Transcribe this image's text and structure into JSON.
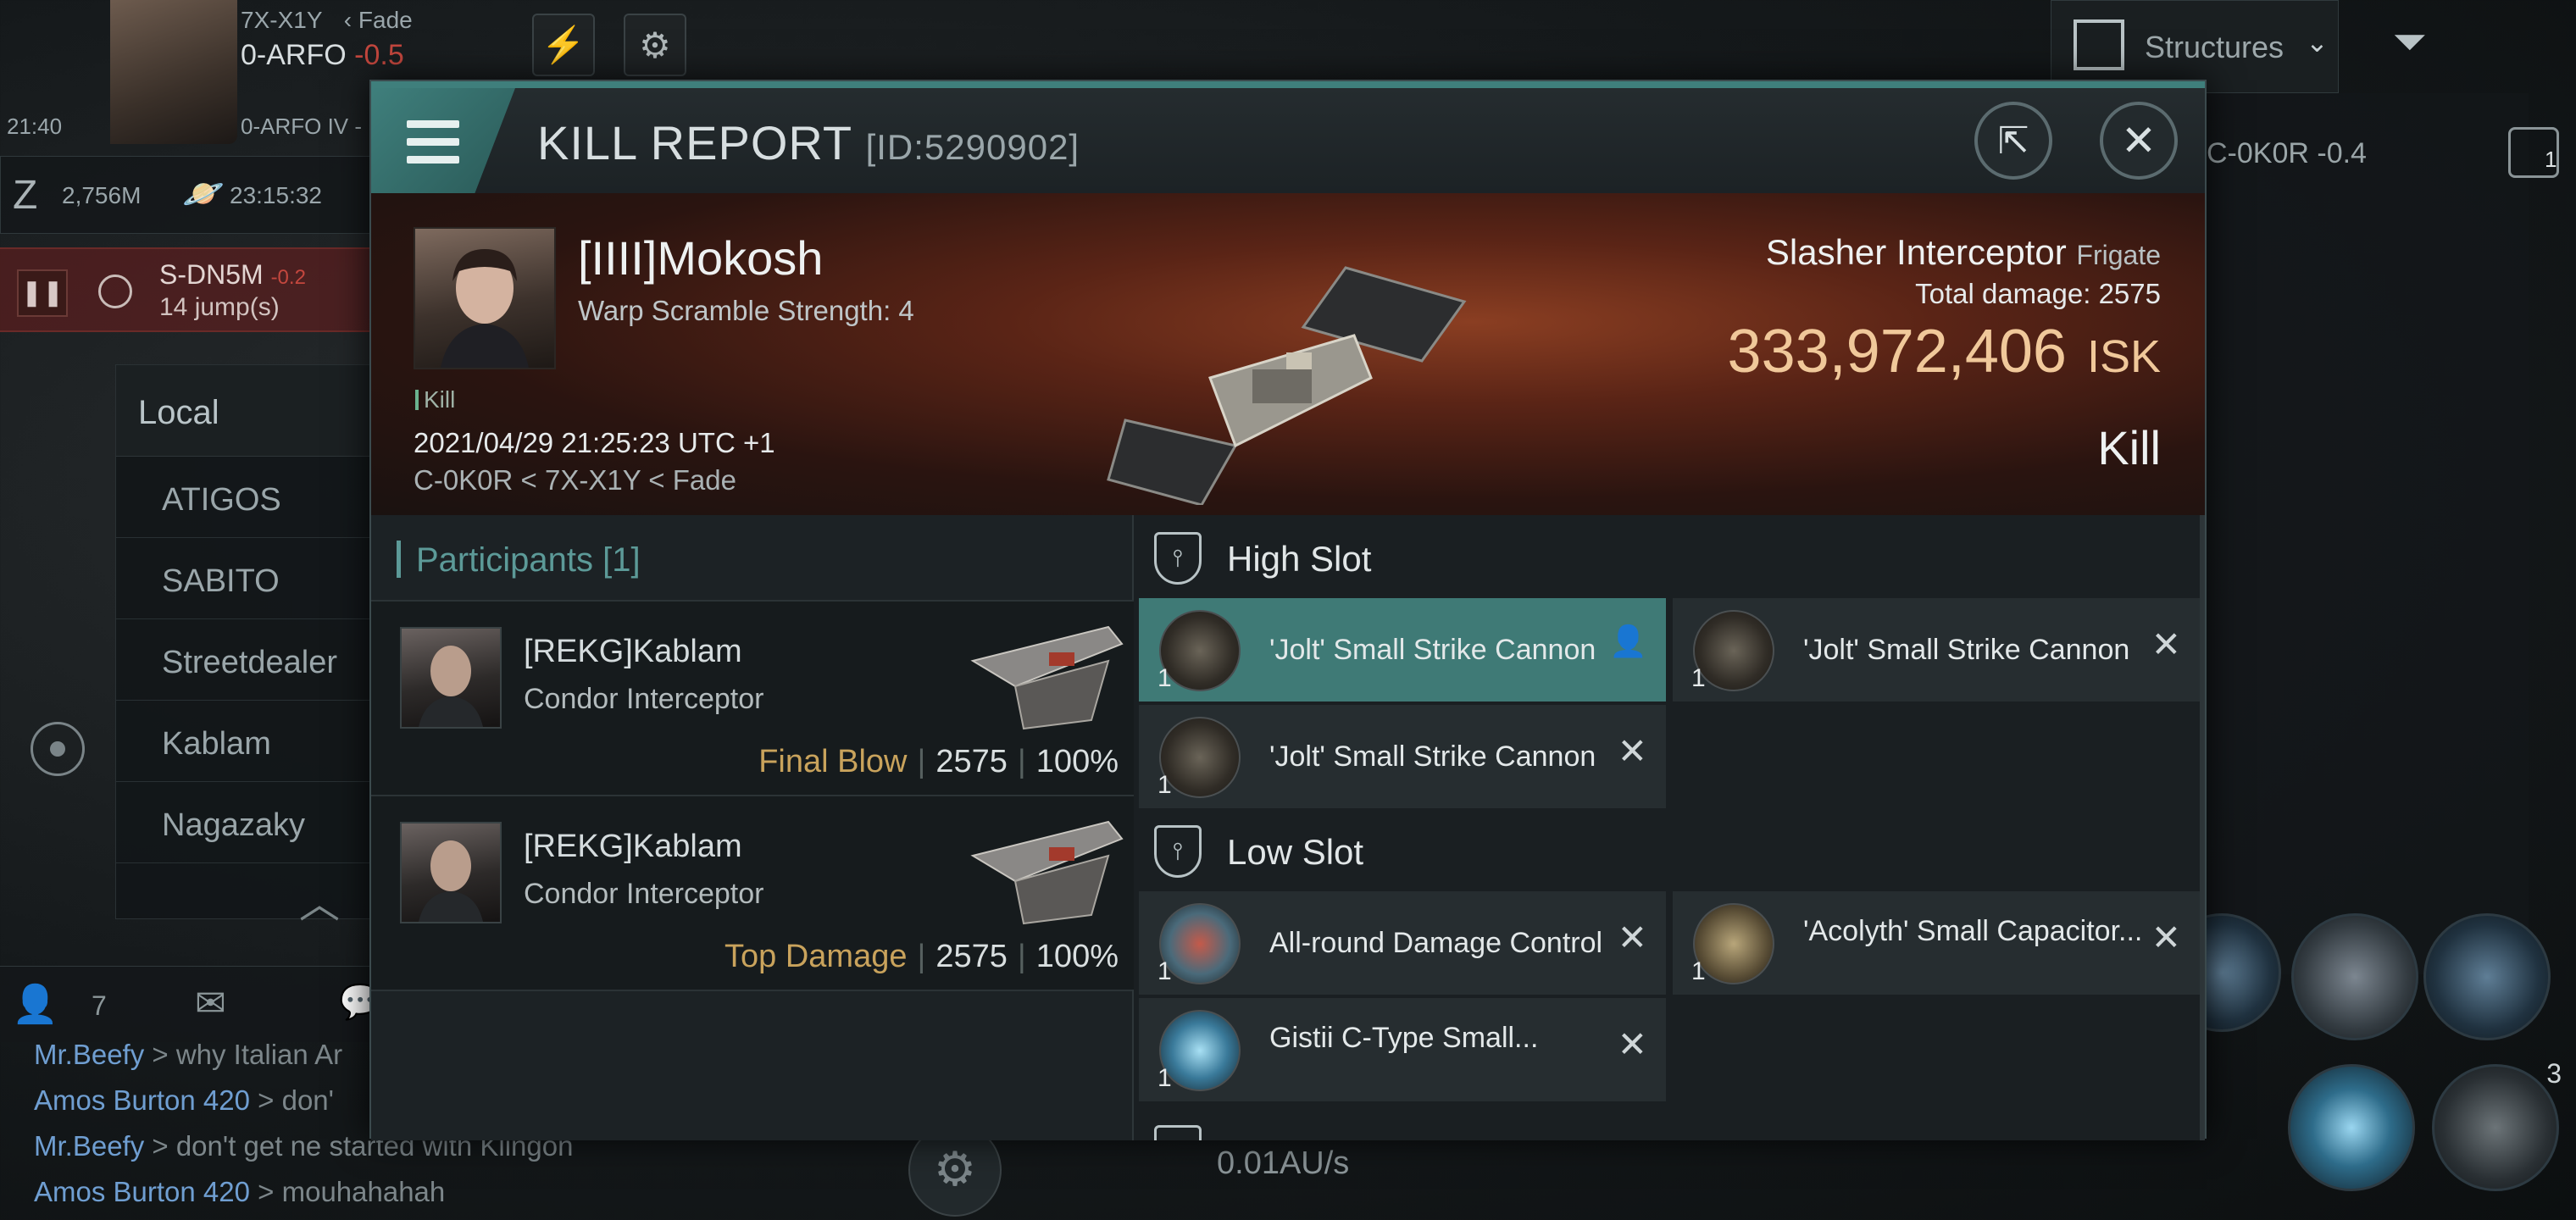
{
  "hud": {
    "system_region": "7X-X1Y",
    "constellation": "Fade",
    "system_name": "0-ARFO",
    "security": "-0.5",
    "station": "0-ARFO IV -",
    "time": "21:40",
    "wallet": "2,756M",
    "clock": "23:15:32",
    "route_dest": "S-DN5M",
    "route_sec": "-0.2",
    "route_jumps": "14 jump(s)",
    "structures_label": "Structures",
    "overview_item": "C-0K0R -0.4",
    "speed": "0.01AU/s",
    "chat_count": "7",
    "module_badge": "3",
    "drone_count": "1"
  },
  "local": {
    "title": "Local",
    "members": [
      "ATIGOS",
      "SABITO",
      "Streetdealer",
      "Kablam",
      "Nagazaky"
    ]
  },
  "chat": [
    {
      "name": "Mr.Beefy",
      "msg": "> why Italian Ar"
    },
    {
      "name": "Amos Burton 420",
      "msg": "> don'"
    },
    {
      "name": "Mr.Beefy",
      "msg": "> don't get ne started with Klingon"
    },
    {
      "name": "Amos Burton 420",
      "msg": "> mouhahahah"
    }
  ],
  "report": {
    "title": "KILL REPORT",
    "report_id": "[ID:5290902]",
    "victim": {
      "name": "[IIII]Mokosh",
      "warp_scramble": "Warp Scramble Strength: 4",
      "tag": "Kill",
      "timestamp": "2021/04/29 21:25:23 UTC +1",
      "location": "C-0K0R < 7X-X1Y < Fade"
    },
    "ship": {
      "name": "Slasher Interceptor",
      "class": "Frigate",
      "total_damage_label": "Total damage:",
      "total_damage": "2575",
      "isk_value": "333,972,406",
      "isk_unit": "ISK",
      "outcome": "Kill"
    },
    "participants_label": "Participants",
    "participants_count": "[1]",
    "participants": [
      {
        "name": "[REKG]Kablam",
        "ship": "Condor Interceptor",
        "role": "Final Blow",
        "damage": "2575",
        "percent": "100%"
      },
      {
        "name": "[REKG]Kablam",
        "ship": "Condor Interceptor",
        "role": "Top Damage",
        "damage": "2575",
        "percent": "100%"
      }
    ],
    "high_slot": {
      "title": "High Slot",
      "modules": [
        {
          "name": "'Jolt' Small Strike Cannon",
          "qty": "1"
        },
        {
          "name": "'Jolt' Small Strike Cannon",
          "qty": "1"
        },
        {
          "name": "'Jolt' Small Strike Cannon",
          "qty": "1"
        }
      ]
    },
    "low_slot": {
      "title": "Low Slot",
      "modules": [
        {
          "name": "All-round Damage Control",
          "qty": "1"
        },
        {
          "name": "'Acolyth' Small Capacitor...",
          "qty": "1"
        },
        {
          "name": "Gistii C-Type Small...",
          "qty": "1"
        }
      ]
    },
    "close_glyph": "✕"
  }
}
